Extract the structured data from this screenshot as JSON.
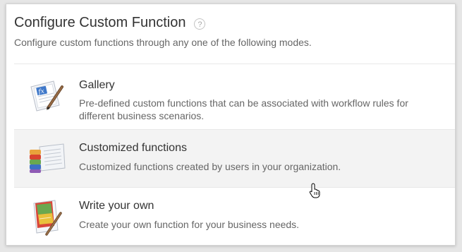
{
  "dialog": {
    "title": "Configure Custom Function",
    "help_glyph": "?",
    "subtitle": "Configure custom functions through any one of the following modes."
  },
  "options": [
    {
      "title": "Gallery",
      "description": "Pre-defined custom functions that can be associated with workflow rules for different business scenarios.",
      "icon": "gallery-fx-document-icon"
    },
    {
      "title": "Customized functions",
      "description": "Customized functions created by users in your organization.",
      "icon": "stacked-books-document-icon"
    },
    {
      "title": "Write your own",
      "description": "Create your own function for your business needs.",
      "icon": "notebook-pencil-icon"
    }
  ],
  "colors": {
    "hover_row_background": "#f3f3f3",
    "title_text": "#333333",
    "secondary_text": "#666666"
  }
}
